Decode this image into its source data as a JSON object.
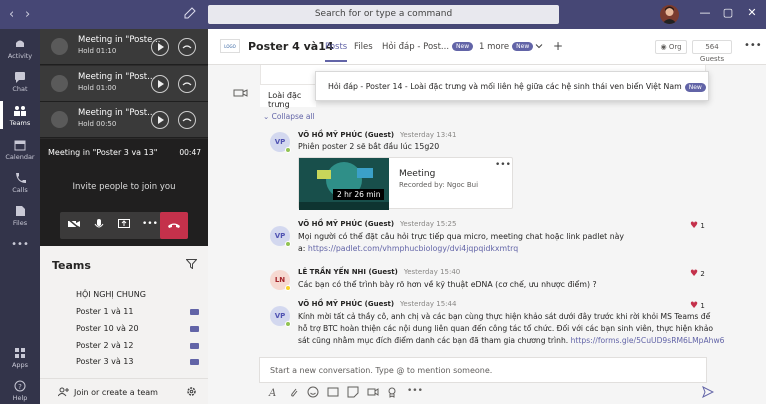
{
  "titlebar": {
    "back": "‹",
    "forward": "›",
    "search_placeholder": "Search for or type a command",
    "window_minimize": "—",
    "window_maximize": "▢",
    "window_close": "✕"
  },
  "rail": {
    "items": [
      {
        "label": "Activity",
        "icon": "bell-icon"
      },
      {
        "label": "Chat",
        "icon": "chat-icon"
      },
      {
        "label": "Teams",
        "icon": "teams-icon"
      },
      {
        "label": "Calendar",
        "icon": "calendar-icon"
      },
      {
        "label": "Calls",
        "icon": "phone-icon"
      },
      {
        "label": "Files",
        "icon": "files-icon"
      },
      {
        "label": "•••",
        "icon": "more-icon"
      },
      {
        "label": "Apps",
        "icon": "apps-icon"
      },
      {
        "label": "Help",
        "icon": "help-icon"
      }
    ]
  },
  "calls": [
    {
      "title": "Meeting in \"Poste...",
      "status": "Hold  01:10"
    },
    {
      "title": "Meeting in \"Post...",
      "status": "Hold  01:00"
    },
    {
      "title": "Meeting in \"Post...",
      "status": "Hold  00:50"
    }
  ],
  "active_meeting": {
    "title": "Meeting in \"Poster 3 va 13\"",
    "time": "00:47",
    "invite": "Invite people to join you"
  },
  "teams": {
    "heading": "Teams",
    "items": [
      "HỘI NGHỊ CHUNG",
      "Poster 1 và 11",
      "Poster 10 và 20",
      "Poster 2 và 12",
      "Poster 3 và 13"
    ],
    "join": "Join or create a team"
  },
  "channel": {
    "logo_text": "LOGO",
    "name": "Poster 4 và14",
    "tabs": [
      "Posts",
      "Files",
      "Hỏi đáp - Post...",
      "1 more"
    ],
    "new_badge": "New",
    "org": "Org",
    "guests": "564 Guests"
  },
  "feed": {
    "prev_thread": "Loài đặc trưng",
    "popover": "Hỏi đáp - Poster 14 - Loài đặc trưng và mối liên hệ giữa các hệ sinh thái ven biển Việt Nam",
    "collapse": "Collapse all",
    "messages": [
      {
        "initials": "VP",
        "name": "VÕ HỒ MỸ PHÚC (Guest)",
        "time": "Yesterday 13:41",
        "lines": [
          "Phiên poster 2 sẽ bắt đầu lúc 15g20"
        ]
      },
      {
        "initials": "VP",
        "name": "VÕ HỒ MỸ PHÚC (Guest)",
        "time": "Yesterday 15:25",
        "lines": [
          "Mọi người có thể đặt câu hỏi trực tiếp qua micro, meeting chat hoặc link padlet này",
          "a: "
        ],
        "link": "https://padlet.com/vhmphucbiology/dvi4jqpqidkxmtrq",
        "reaction": "1"
      },
      {
        "initials": "LN",
        "name": "LÊ TRẦN YẾN NHI (Guest)",
        "time": "Yesterday 15:40",
        "lines": [
          "Các bạn có thể trình bày rõ hơn về kỹ thuật eDNA (cơ chế, ưu nhược điểm) ?"
        ],
        "reaction": "2"
      },
      {
        "initials": "VP",
        "name": "VÕ HỒ MỸ PHÚC (Guest)",
        "time": "Yesterday 15:44",
        "lines": [
          "Kính mời tất cả thầy cô, anh chị và các bạn cùng thực hiện khảo sát dưới đây trước khi rời khỏi MS Teams để",
          "hỗ trợ BTC hoàn thiện các nội dung liên quan đến công tác tổ chức. Đối với các bạn sinh viên, thực hiện khảo",
          "sát cũng nhằm mục đích điểm danh các bạn đã tham gia chương trình. "
        ],
        "link": "https://forms.gle/5CuUD9sRM6LMpAhw6",
        "reaction": "1"
      }
    ],
    "recording": {
      "title": "Meeting",
      "by": "Recorded by: Ngoc Bui",
      "duration": "2 hr 26 min"
    }
  },
  "composer": {
    "placeholder": "Start a new conversation. Type @ to mention someone."
  },
  "colors": {
    "brand": "#6264a7",
    "titlebar": "#464775",
    "rail": "#33344a",
    "hangup": "#c4314b"
  }
}
